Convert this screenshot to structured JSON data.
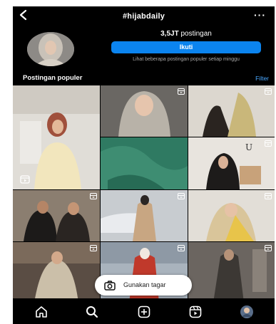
{
  "header": {
    "back_icon": "chevron-left-icon",
    "title": "#hijabdaily",
    "more_icon": "more-horizontal-icon",
    "more_label": "···"
  },
  "profile": {
    "post_count_value": "3,5JT",
    "post_count_suffix": "postingan",
    "follow_label": "Ikuti",
    "see_posts_text": "Lihat beberapa postingan populer setiap minggu"
  },
  "section": {
    "title": "Postingan populer",
    "filter_label": "Filter"
  },
  "grid": {
    "tiles": [
      {
        "name": "post-1",
        "reel": false
      },
      {
        "name": "post-2",
        "reel": true
      },
      {
        "name": "post-3",
        "reel": true
      },
      {
        "name": "post-4",
        "reel": false
      },
      {
        "name": "post-5",
        "reel": true
      },
      {
        "name": "post-6",
        "reel": true
      },
      {
        "name": "post-7",
        "reel": true
      },
      {
        "name": "post-8",
        "reel": true
      },
      {
        "name": "post-9",
        "reel": true
      },
      {
        "name": "post-10",
        "reel": true
      },
      {
        "name": "post-11",
        "reel": true
      },
      {
        "name": "post-12",
        "reel": true
      }
    ],
    "watermark_text": "U"
  },
  "use_tag_button": {
    "icon": "camera-icon",
    "label": "Gunakan tagar"
  },
  "bottom_nav": {
    "items": [
      {
        "name": "home",
        "icon": "home-icon"
      },
      {
        "name": "search",
        "icon": "search-icon"
      },
      {
        "name": "create",
        "icon": "add-post-icon"
      },
      {
        "name": "reels",
        "icon": "reels-icon"
      },
      {
        "name": "profile",
        "icon": "avatar-icon"
      }
    ]
  },
  "colors": {
    "background": "#000000",
    "accent": "#0b84ef",
    "link": "#4aa8ff",
    "muted_text": "#a8a8a8"
  }
}
